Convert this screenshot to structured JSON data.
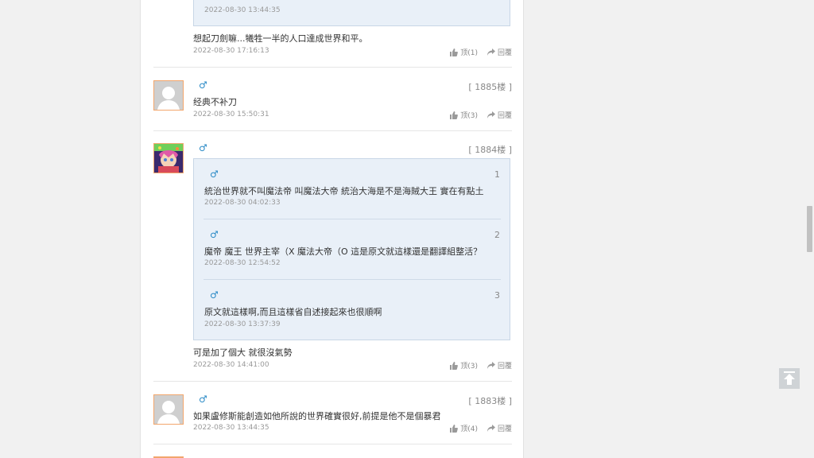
{
  "top_quote": {
    "time": "2022-08-30 13:44:35"
  },
  "comment0": {
    "text": "想起刀劍嘛...犧牲一半的人口達成世界和平。",
    "time": "2022-08-30 17:16:13",
    "like": "顶(1)",
    "reply": "回覆"
  },
  "c1885": {
    "gender": "♂",
    "floor": "[ 1885楼 ]",
    "text": "经典不补刀",
    "time": "2022-08-30 15:50:31",
    "like": "顶(3)",
    "reply": "回覆"
  },
  "c1884": {
    "gender": "♂",
    "floor": "[ 1884楼 ]",
    "quotes": [
      {
        "gender": "♂",
        "num": "1",
        "text": "統治世界就不叫魔法帝 叫魔法大帝 統治大海是不是海賊大王 實在有點土",
        "time": "2022-08-30 04:02:33"
      },
      {
        "gender": "♂",
        "num": "2",
        "text": "魔帝 魔王 世界主宰（X 魔法大帝（O 這是原文就這樣還是翻譯組整活？",
        "time": "2022-08-30 12:54:52"
      },
      {
        "gender": "♂",
        "num": "3",
        "text": "原文就這樣啊,而且這樣省自述接起來也很順啊",
        "time": "2022-08-30 13:37:39"
      }
    ],
    "text": "可是加了個大 就很沒氣勢",
    "time": "2022-08-30 14:41:00",
    "like": "顶(3)",
    "reply": "回覆"
  },
  "c1883": {
    "gender": "♂",
    "floor": "[ 1883楼 ]",
    "text": "如果盧修斯能創造如他所說的世界確實很好,前提是他不是個暴君",
    "time": "2022-08-30 13:44:35",
    "like": "顶(4)",
    "reply": "回覆"
  },
  "colors": {
    "link_blue": "#2a8ac6",
    "quote_bg": "#e9f0f8",
    "avatar_border": "#f2a66c"
  },
  "icons": {
    "like": "thumbs-up-icon",
    "reply": "share-arrow-icon",
    "back_to_top": "arrow-up-icon"
  }
}
